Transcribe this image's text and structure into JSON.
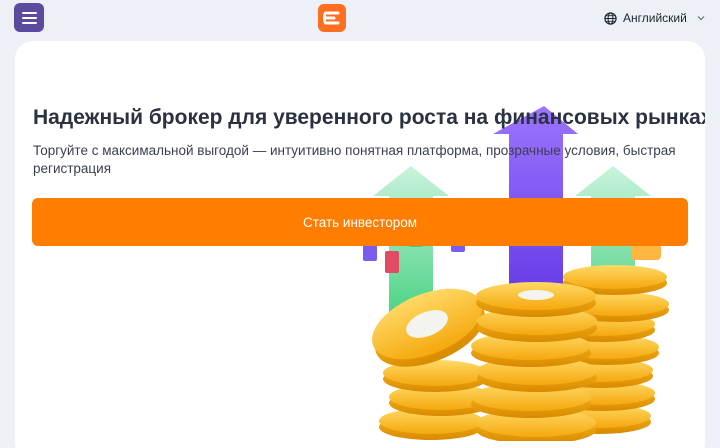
{
  "header": {
    "menu_icon": "hamburger-menu-icon",
    "logo_icon": "brand-logo",
    "language": {
      "icon": "globe-icon",
      "label": "Английский",
      "chevron": "chevron-down-icon"
    }
  },
  "hero": {
    "title": "Надежный брокер для уверенного роста на финансовых рынках",
    "subtitle": "Торгуйте с максимальной выгодой — интуитивно понятная платформа, прозрачные условия, быстрая регистрация",
    "cta_label": "Стать инвестором",
    "illustration": "growth-arrows-and-gold-coins-illustration"
  },
  "colors": {
    "page_bg": "#eef0f7",
    "menu_button": "#5b4a9e",
    "brand_orange": "#ff6e21",
    "cta_orange": "#ff7d00",
    "heading": "#2b3140"
  }
}
